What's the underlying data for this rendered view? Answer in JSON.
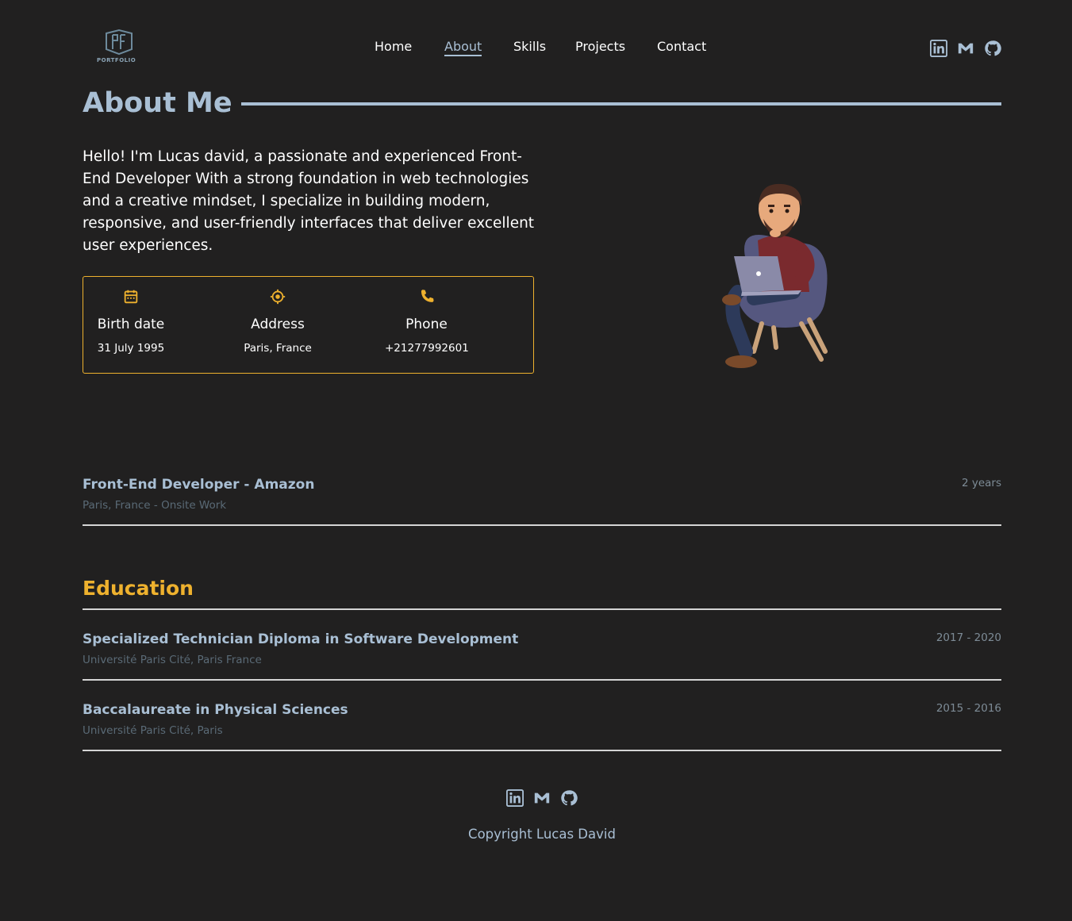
{
  "logo": {
    "text": "PORTFOLIO"
  },
  "nav": {
    "items": [
      {
        "label": "Home"
      },
      {
        "label": "About"
      },
      {
        "label": "Skills"
      },
      {
        "label": "Projects"
      },
      {
        "label": "Contact"
      }
    ],
    "active": "About"
  },
  "socials": [
    "linkedin-icon",
    "gmail-icon",
    "github-icon"
  ],
  "about": {
    "title": "About Me",
    "intro": "Hello! I'm Lucas david, a passionate and experienced Front-End Developer With a strong foundation in web technologies and a creative mindset, I specialize in building modern, responsive, and user-friendly interfaces that deliver excellent user experiences.",
    "info": [
      {
        "icon": "calendar-icon",
        "label": "Birth date",
        "value": "31 July 1995"
      },
      {
        "icon": "location-icon",
        "label": "Address",
        "value": "Paris, France"
      },
      {
        "icon": "phone-icon",
        "label": "Phone",
        "value": "+21277992601"
      }
    ]
  },
  "experience": [
    {
      "title": "Front-End Developer - Amazon",
      "subtitle": "Paris, France - Onsite Work",
      "period": "2 years"
    }
  ],
  "education": {
    "title": "Education",
    "items": [
      {
        "title": "Specialized Technician Diploma in Software Development",
        "subtitle": "Université Paris Cité, Paris France",
        "period": "2017 - 2020"
      },
      {
        "title": "Baccalaureate in Physical Sciences",
        "subtitle": "Université Paris Cité, Paris",
        "period": "2015 - 2016"
      }
    ]
  },
  "footer": {
    "copyright": "Copyright Lucas David"
  },
  "colors": {
    "background": "#212020",
    "accent": "#a9bfd4",
    "highlight": "#eeb12e"
  }
}
